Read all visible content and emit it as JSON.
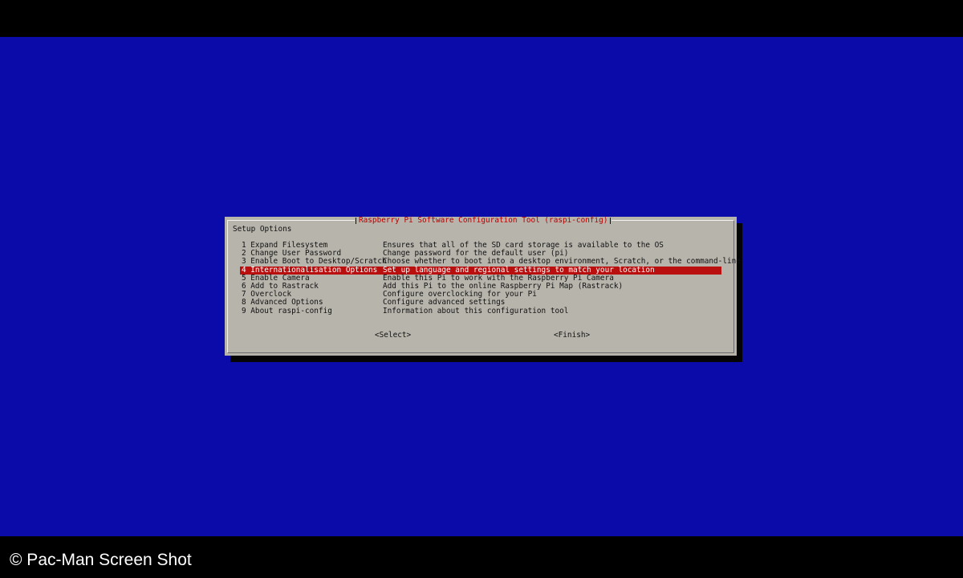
{
  "dialog": {
    "title": "Raspberry Pi Software Configuration Tool (raspi-config)",
    "heading": "Setup Options",
    "selected_index": 3,
    "items": [
      {
        "label": "1 Expand Filesystem",
        "description": "Ensures that all of the SD card storage is available to the OS"
      },
      {
        "label": "2 Change User Password",
        "description": "Change password for the default user (pi)"
      },
      {
        "label": "3 Enable Boot to Desktop/Scratch",
        "description": "Choose whether to boot into a desktop environment, Scratch, or the command-line"
      },
      {
        "label": "4 Internationalisation Options",
        "description": "Set up language and regional settings to match your location"
      },
      {
        "label": "5 Enable Camera",
        "description": "Enable this Pi to work with the Raspberry Pi Camera"
      },
      {
        "label": "6 Add to Rastrack",
        "description": "Add this Pi to the online Raspberry Pi Map (Rastrack)"
      },
      {
        "label": "7 Overclock",
        "description": "Configure overclocking for your Pi"
      },
      {
        "label": "8 Advanced Options",
        "description": "Configure advanced settings"
      },
      {
        "label": "9 About raspi-config",
        "description": "Information about this configuration tool"
      }
    ],
    "buttons": {
      "select": "<Select>",
      "finish": "<Finish>"
    }
  },
  "caption": "© Pac-Man Screen Shot",
  "colors": {
    "terminal_background": "#0a0ba8",
    "dialog_background": "#b7b4ac",
    "title_text": "#b30000",
    "selection_background": "#b90f0f",
    "selection_text": "#ffffff"
  }
}
